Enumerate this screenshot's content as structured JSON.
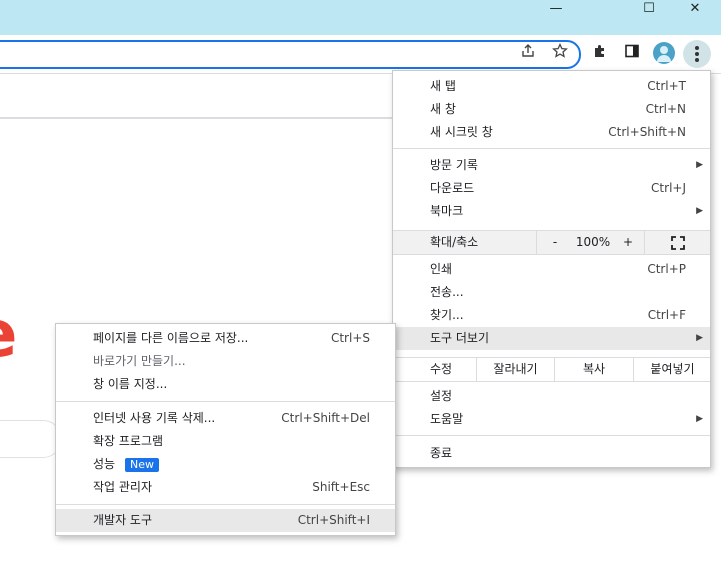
{
  "window": {
    "minimize_glyph": "—",
    "restore_glyph": "☐",
    "close_glyph": "✕"
  },
  "toolbar": {
    "share_icon": "share-icon",
    "star_icon": "star-icon",
    "extensions_icon": "puzzle-icon",
    "sidepanel_icon": "side-panel-icon",
    "avatar_icon": "profile-avatar-icon",
    "menu_icon": "more-vert-icon"
  },
  "page": {
    "logo_letter": "e"
  },
  "main_menu": {
    "new_tab": {
      "label": "새 탭",
      "shortcut": "Ctrl+T"
    },
    "new_window": {
      "label": "새 창",
      "shortcut": "Ctrl+N"
    },
    "incognito": {
      "label": "새 시크릿 창",
      "shortcut": "Ctrl+Shift+N"
    },
    "history": {
      "label": "방문 기록"
    },
    "downloads": {
      "label": "다운로드",
      "shortcut": "Ctrl+J"
    },
    "bookmarks": {
      "label": "북마크"
    },
    "zoom": {
      "label": "확대/축소",
      "minus": "-",
      "value": "100%",
      "plus": "+"
    },
    "print": {
      "label": "인쇄",
      "shortcut": "Ctrl+P"
    },
    "cast": {
      "label": "전송..."
    },
    "find": {
      "label": "찾기...",
      "shortcut": "Ctrl+F"
    },
    "more_tools": {
      "label": "도구 더보기"
    },
    "edit": {
      "label": "수정",
      "cut": "잘라내기",
      "copy": "복사",
      "paste": "붙여넣기"
    },
    "settings": {
      "label": "설정"
    },
    "help": {
      "label": "도움말"
    },
    "exit": {
      "label": "종료"
    }
  },
  "sub_menu": {
    "save_page": {
      "label": "페이지를 다른 이름으로 저장...",
      "shortcut": "Ctrl+S"
    },
    "create_shortcut": {
      "label": "바로가기 만들기..."
    },
    "name_window": {
      "label": "창 이름 지정..."
    },
    "clear_data": {
      "label": "인터넷 사용 기록 삭제...",
      "shortcut": "Ctrl+Shift+Del"
    },
    "extensions": {
      "label": "확장 프로그램"
    },
    "performance": {
      "label": "성능",
      "badge": "New"
    },
    "task_manager": {
      "label": "작업 관리자",
      "shortcut": "Shift+Esc"
    },
    "devtools": {
      "label": "개발자 도구",
      "shortcut": "Ctrl+Shift+I"
    }
  },
  "colors": {
    "titlebar": "#bde7f2",
    "accent": "#1a73e8",
    "logo": "#ea4335",
    "highlight": "#e8e8e8"
  }
}
